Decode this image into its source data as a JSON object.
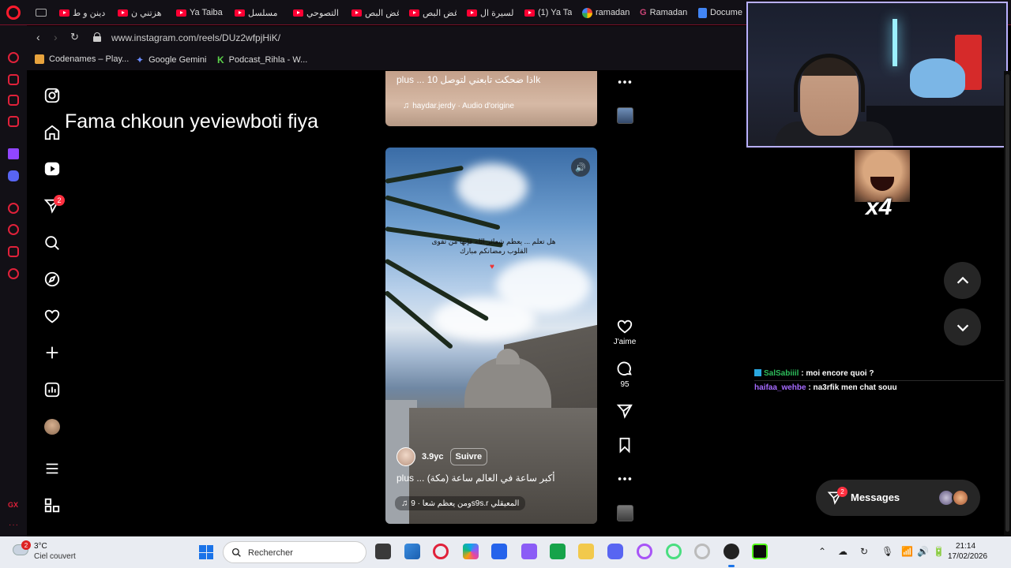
{
  "browser": {
    "tabs": [
      {
        "label": "دينن و ط",
        "icon": "youtube-icon"
      },
      {
        "label": "هزتني ن",
        "icon": "youtube-icon"
      },
      {
        "label": "Ya Taiba",
        "icon": "youtube-icon"
      },
      {
        "label": "مسلسل",
        "icon": "youtube-icon"
      },
      {
        "label": "التصوحي",
        "icon": "youtube-icon"
      },
      {
        "label": "غض البص",
        "icon": "youtube-icon"
      },
      {
        "label": "غض البص",
        "icon": "youtube-icon"
      },
      {
        "label": "السيرة ال",
        "icon": "youtube-icon"
      },
      {
        "label": "(1) Ya Ta",
        "icon": "youtube-icon"
      },
      {
        "label": "ramadan",
        "icon": "google-icon"
      },
      {
        "label": "Ramadan",
        "icon": "gx-icon"
      },
      {
        "label": "Docume",
        "icon": "docs-icon"
      }
    ],
    "url": "www.instagram.com/reels/DUz2wfpjHiK/",
    "bookmarks": [
      {
        "label": "Codenames – Play...",
        "color": "#e8a33d"
      },
      {
        "label": "Google Gemini",
        "color": "#6b8cff"
      },
      {
        "label": "Podcast_Rihla - W...",
        "color": "#5bd14a"
      }
    ]
  },
  "overlay_text": "Fama chkoun yeviewboti fiya",
  "instagram": {
    "nav_badge": "2",
    "top_reel": {
      "caption": "plus ... اذا ضحكت تابعني لتوصل 10k",
      "audio": "haydar.jerdy · Audio d'origine"
    },
    "main_reel": {
      "overlay": "هل تعلم ... يعظم شعائر الله فإنها من تقوى القلوب رمضانكم مبارك",
      "username": "3.9yc",
      "follow": "Suivre",
      "caption": "plus ... أكبر ساعة في العالم ساعة (مكة)",
      "audio": "ومن يعظم شعا · 9s9s.r المعيقلي"
    },
    "actions": {
      "like_label": "J'aime",
      "comments": "95"
    },
    "messages": {
      "label": "Messages",
      "badge": "2"
    }
  },
  "stream": {
    "emote_text": "x4",
    "chat": [
      {
        "user": "SalSabiiil",
        "color": "#2dbd5b",
        "text": " : moi encore quoi ?"
      },
      {
        "user": "haifaa_wehbe",
        "color": "#a66bff",
        "text": " : na3rfik men chat souu"
      }
    ]
  },
  "taskbar": {
    "weather_temp": "3°C",
    "weather_desc": "Ciel couvert",
    "weather_badge": "2",
    "search_placeholder": "Rechercher",
    "time": "21:14",
    "date": "17/02/2026"
  }
}
